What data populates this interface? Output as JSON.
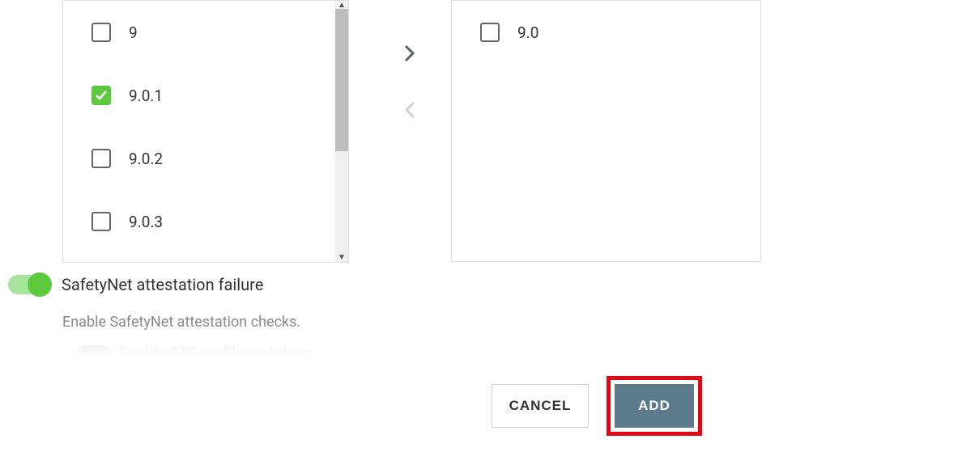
{
  "leftList": {
    "items": [
      {
        "label": "9",
        "checked": false
      },
      {
        "label": "9.0.1",
        "checked": true
      },
      {
        "label": "9.0.2",
        "checked": false
      },
      {
        "label": "9.0.3",
        "checked": false
      }
    ]
  },
  "rightList": {
    "items": [
      {
        "label": "9.0",
        "checked": false
      }
    ]
  },
  "safetynet": {
    "title": "SafetyNet attestation failure",
    "description": "Enable SafetyNet attestation checks.",
    "partial": "Enable CTS profile matching"
  },
  "buttons": {
    "cancel": "CANCEL",
    "add": "ADD"
  }
}
